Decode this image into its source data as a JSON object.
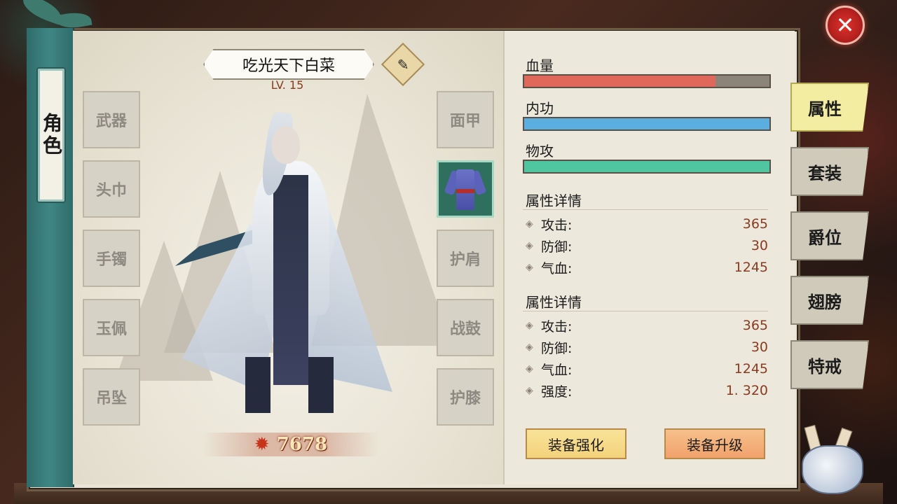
{
  "side": {
    "role_tab": "角色"
  },
  "character": {
    "name": "吃光天下白菜",
    "level": "LV. 15",
    "power": "7678",
    "edit_icon": "brush-icon"
  },
  "slots_left": [
    "武器",
    "头巾",
    "手镯",
    "玉佩",
    "吊坠"
  ],
  "slots_right": [
    "面甲",
    "",
    "护肩",
    "战鼓",
    "护膝"
  ],
  "equipped_item_icon": "robe-icon",
  "bars": [
    {
      "label": "血量",
      "value_fraction": 0.78,
      "color": "#e0685a"
    },
    {
      "label": "内功",
      "value_fraction": 1.0,
      "color": "#5aaee0"
    },
    {
      "label": "物攻",
      "value_fraction": 1.0,
      "color": "#4fc6a0"
    }
  ],
  "details1": {
    "title": "属性详情",
    "rows": [
      {
        "key": "攻击:",
        "value": "365"
      },
      {
        "key": "防御:",
        "value": "30"
      },
      {
        "key": "气血:",
        "value": "1245"
      }
    ]
  },
  "details2": {
    "title": "属性详情",
    "rows": [
      {
        "key": "攻击:",
        "value": "365"
      },
      {
        "key": "防御:",
        "value": "30"
      },
      {
        "key": "气血:",
        "value": "1245"
      },
      {
        "key": "强度:",
        "value": "1. 320"
      }
    ]
  },
  "buttons": {
    "enhance": "装备强化",
    "upgrade": "装备升级"
  },
  "tabs": [
    {
      "label": "属性",
      "active": true
    },
    {
      "label": "套装",
      "active": false
    },
    {
      "label": "爵位",
      "active": false
    },
    {
      "label": "翅膀",
      "active": false
    },
    {
      "label": "特戒",
      "active": false
    }
  ],
  "close_icon": "close-icon",
  "colors": {
    "accent_teal": "#3f8784",
    "active_tab": "#f2eda1",
    "button_gold": "#f4d27a",
    "button_orange": "#f1a26a"
  }
}
